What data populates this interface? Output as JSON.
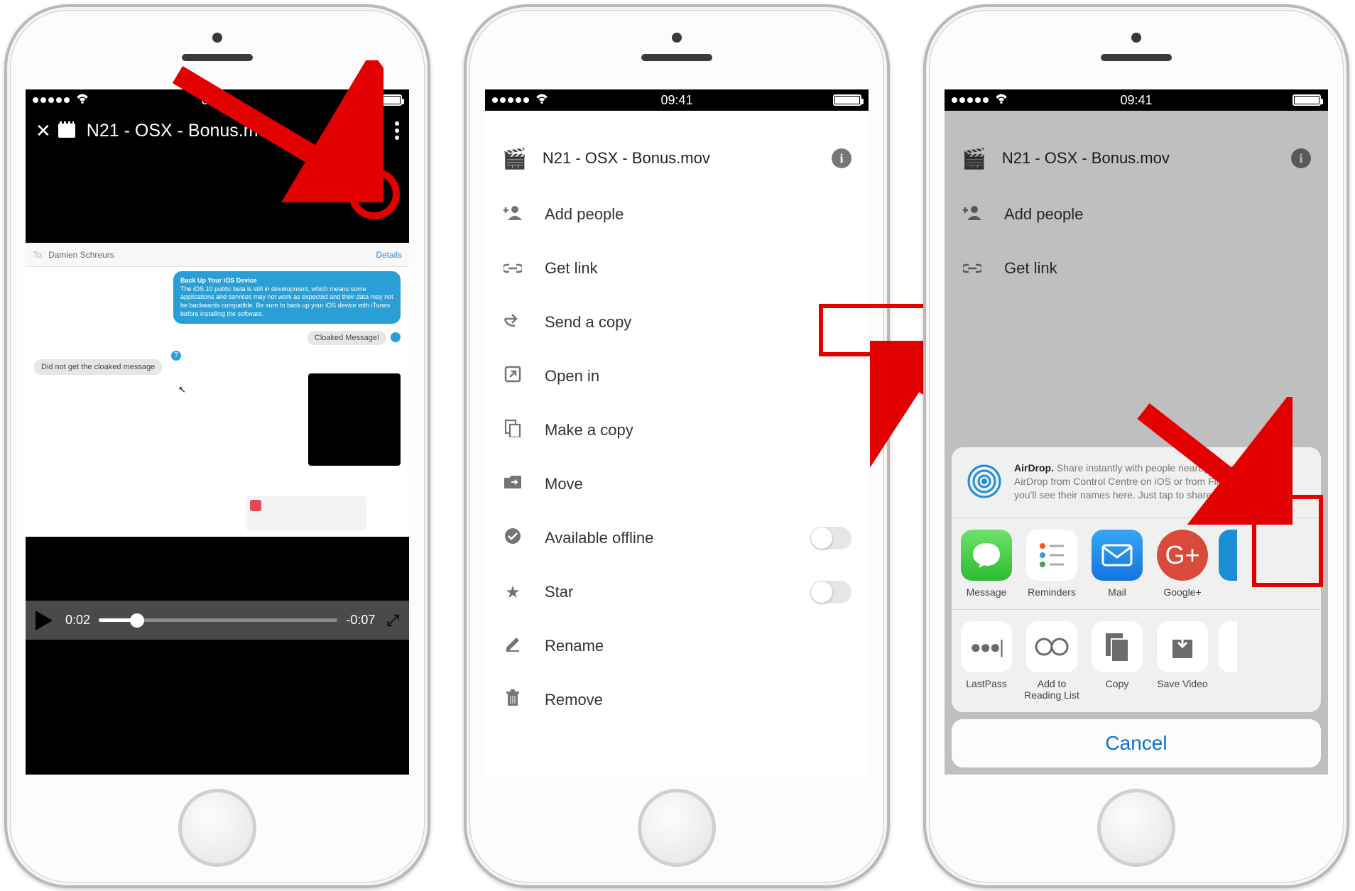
{
  "status": {
    "time": "09:41"
  },
  "screen1": {
    "file_name": "N21 - OSX - Bonus.m…",
    "chat": {
      "to_label": "To:",
      "recipient": "Damien Schreurs",
      "details_label": "Details",
      "blue_title": "Back Up Your iOS Device",
      "blue_body": "The iOS 10 public beta is still in development, which means some applications and services may not work as expected and their data may not be backwards compatible. Be sure to back up your iOS device with iTunes before installing the software.",
      "cloaked_label": "Cloaked Message!",
      "reply_label": "Did not get the cloaked message"
    },
    "controls": {
      "time_elapsed": "0:02",
      "time_remaining": "-0:07"
    }
  },
  "screen2": {
    "file_name": "N21 - OSX - Bonus.mov",
    "menu": {
      "add_people": "Add people",
      "get_link": "Get link",
      "send_copy": "Send a copy",
      "open_in": "Open in",
      "make_copy": "Make a copy",
      "move": "Move",
      "offline": "Available offline",
      "star": "Star",
      "rename": "Rename",
      "remove": "Remove"
    }
  },
  "screen3": {
    "file_name": "N21 - OSX - Bonus.mov",
    "menu": {
      "add_people": "Add people",
      "get_link": "Get link"
    },
    "sheet": {
      "airdrop_bold": "AirDrop.",
      "airdrop_text": " Share instantly with people nearby. If they turn on AirDrop from Control Centre on iOS or from Finder on the Mac, you'll see their names here. Just tap to share.",
      "apps": {
        "message": "Message",
        "reminders": "Reminders",
        "mail": "Mail",
        "googleplus": "Google+"
      },
      "actions": {
        "lastpass": "LastPass",
        "reading": "Add to Reading List",
        "copy": "Copy",
        "save_video": "Save Video"
      },
      "cancel": "Cancel"
    }
  }
}
